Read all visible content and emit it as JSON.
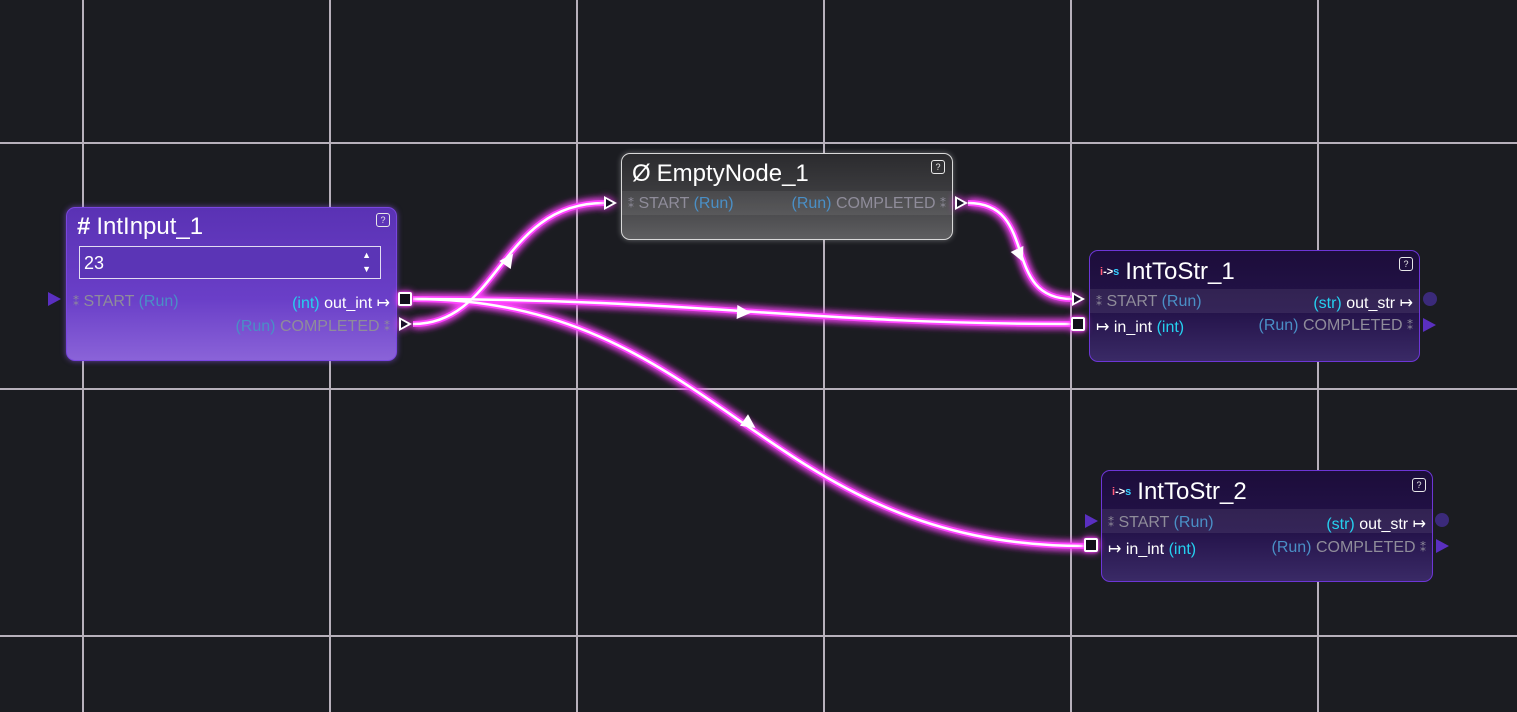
{
  "canvas": {
    "background": "#1b1c21",
    "grid_color": "#b7b0bb",
    "wire_color": "#ff44ff"
  },
  "nodes": {
    "int_input": {
      "icon": "hash-icon",
      "icon_glyph": "#",
      "title": "IntInput_1",
      "help": "?",
      "value": "23",
      "start_symbol": "⁑",
      "start": "START",
      "start_type": "(Run)",
      "out_type": "(int)",
      "out_name": "out_int",
      "out_symbol": "↦",
      "completed_type": "(Run)",
      "completed": "COMPLETED",
      "completed_symbol": "⁑"
    },
    "empty_node": {
      "icon": "empty-set-icon",
      "icon_glyph": "Ø",
      "title": "EmptyNode_1",
      "help": "?",
      "start_symbol": "⁑",
      "start": "START",
      "start_type": "(Run)",
      "completed_type": "(Run)",
      "completed": "COMPLETED",
      "completed_symbol": "⁑"
    },
    "int_to_str_1": {
      "icon": "int-to-str-icon",
      "badge": [
        "i",
        "->",
        "s"
      ],
      "title": "IntToStr_1",
      "help": "?",
      "start_symbol": "⁑",
      "start": "START",
      "start_type": "(Run)",
      "out_type": "(str)",
      "out_name": "out_str",
      "out_symbol": "↦",
      "in_symbol": "↦",
      "in_name": "in_int",
      "in_type": "(int)",
      "completed_type": "(Run)",
      "completed": "COMPLETED",
      "completed_symbol": "⁑"
    },
    "int_to_str_2": {
      "icon": "int-to-str-icon",
      "badge": [
        "i",
        "->",
        "s"
      ],
      "title": "IntToStr_2",
      "help": "?",
      "start_symbol": "⁑",
      "start": "START",
      "start_type": "(Run)",
      "out_type": "(str)",
      "out_name": "out_str",
      "out_symbol": "↦",
      "in_symbol": "↦",
      "in_name": "in_int",
      "in_type": "(int)",
      "completed_type": "(Run)",
      "completed": "COMPLETED",
      "completed_symbol": "⁑"
    }
  }
}
